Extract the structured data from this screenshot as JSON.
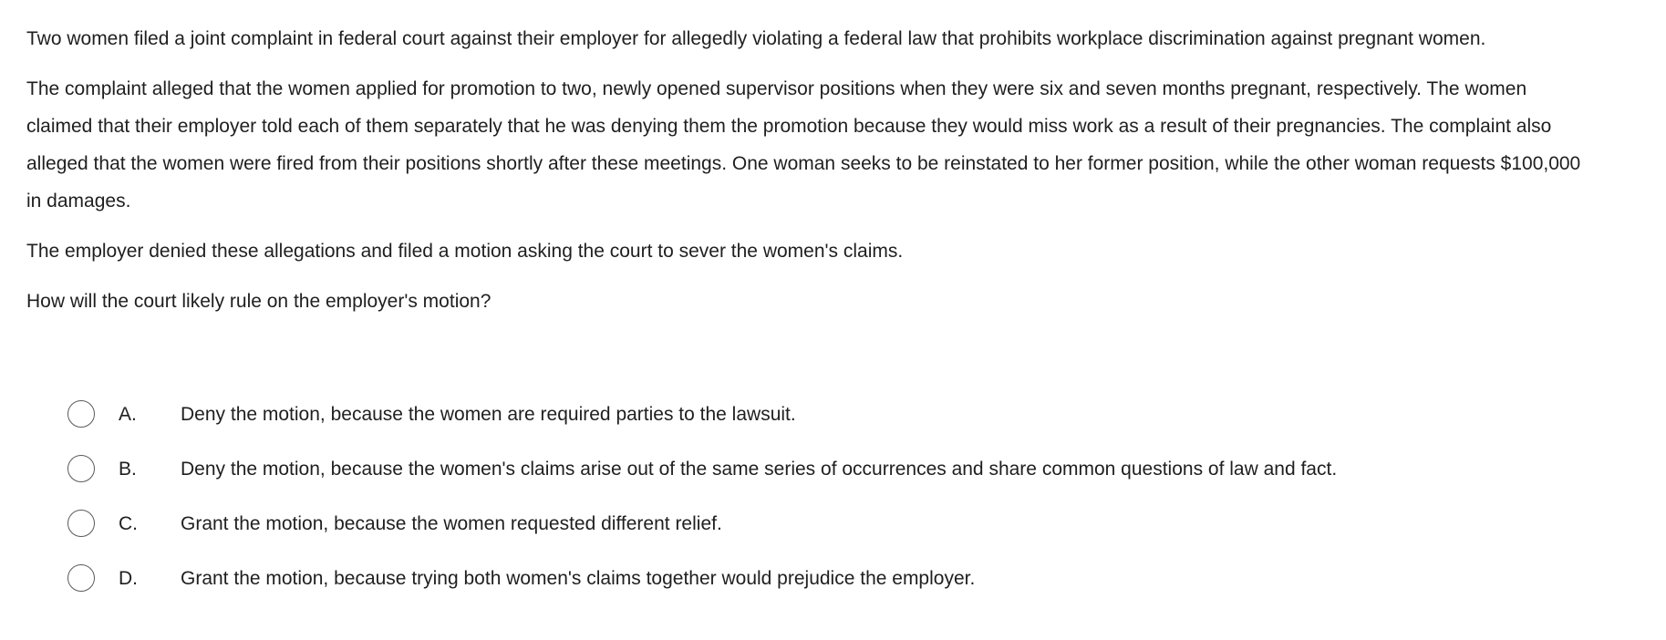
{
  "question": {
    "paragraphs": [
      "Two women filed a joint complaint in federal court against their employer for allegedly violating a federal law that prohibits workplace discrimination against pregnant women.",
      "The complaint alleged that the women applied for promotion to two, newly opened supervisor positions when they were six and seven months pregnant, respectively.  The women claimed that their employer told each of them separately that he was denying them the promotion because they would miss work as a result of their pregnancies.  The complaint also alleged that the women were fired from their positions shortly after these meetings.  One woman seeks to be reinstated to her former position, while the other woman requests $100,000 in damages.",
      "The employer denied these allegations and filed a motion asking the court to sever the women's claims."
    ],
    "stem": "How will the court likely rule on the employer's motion?"
  },
  "choices": [
    {
      "letter": "A.",
      "text": "Deny the motion, because the women are required parties to the lawsuit."
    },
    {
      "letter": "B.",
      "text": "Deny the motion, because the women's claims arise out of the same series of occurrences and share common questions of law and fact."
    },
    {
      "letter": "C.",
      "text": "Grant the motion, because the women requested different relief."
    },
    {
      "letter": "D.",
      "text": "Grant the motion, because trying both women's claims together would prejudice the employer."
    }
  ]
}
